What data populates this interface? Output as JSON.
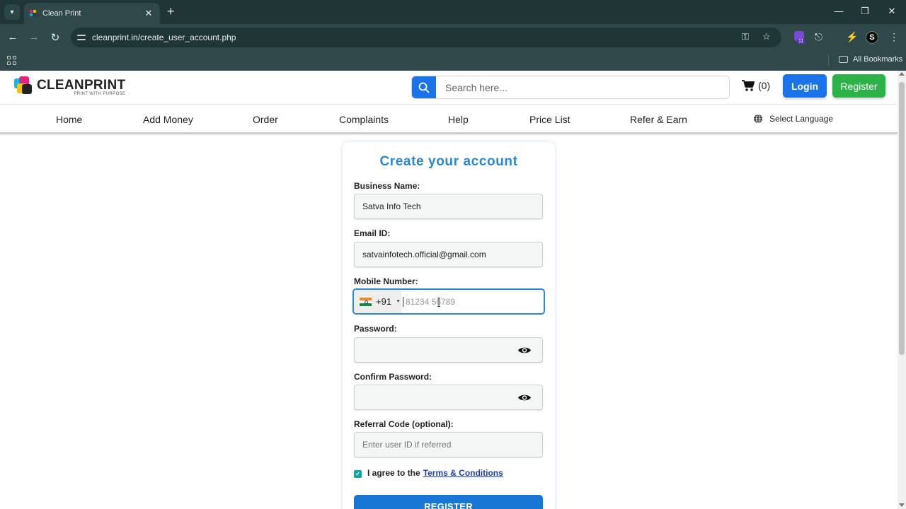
{
  "browser": {
    "tab_title": "Clean Print",
    "url": "cleanprint.in/create_user_account.php",
    "extension_badge": "11",
    "profile_initial": "S",
    "bookmarks_label": "All Bookmarks"
  },
  "header": {
    "logo_name": "CLEANPRINT",
    "logo_tagline": "PRINT WITH PURPOSE",
    "search_placeholder": "Search here...",
    "cart_count": "(0)",
    "login_label": "Login",
    "register_label": "Register",
    "colors": {
      "primary": "#1a73e8",
      "register": "#2db24a"
    }
  },
  "nav": {
    "items": [
      "Home",
      "Add Money",
      "Order",
      "Complaints",
      "Help",
      "Price List",
      "Refer & Earn"
    ],
    "language_label": "Select Language"
  },
  "form": {
    "title": "Create your account",
    "business_name_label": "Business Name:",
    "business_name_value": "Satva Info Tech",
    "email_label": "Email ID:",
    "email_value": "satvainfotech.official@gmail.com",
    "mobile_label": "Mobile Number:",
    "country_code": "+91",
    "mobile_placeholder": "81234 56789",
    "password_label": "Password:",
    "confirm_password_label": "Confirm Password:",
    "referral_label": "Referral Code (optional):",
    "referral_placeholder": "Enter user ID if referred",
    "agree_text": "I agree to the",
    "terms_link": "Terms & Conditions",
    "agree_checked": true,
    "submit_label": "REGISTER",
    "colors": {
      "title": "#2a87d0",
      "submit": "#1877d4",
      "checkbox": "#16a3a3"
    }
  }
}
